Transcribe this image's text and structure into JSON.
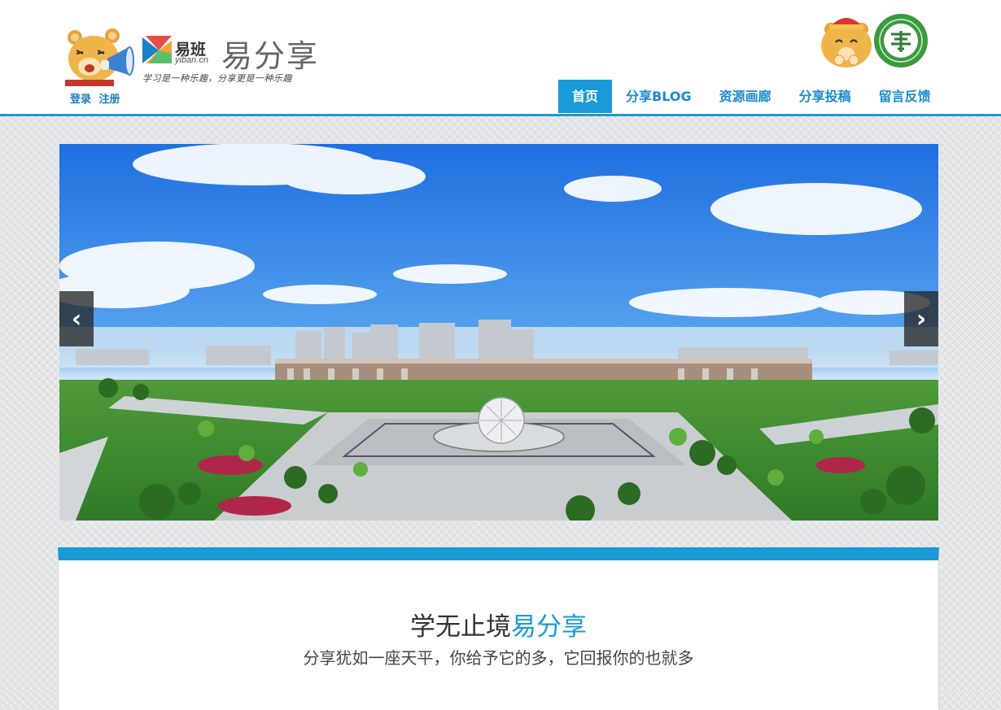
{
  "header": {
    "logo_text": "易班",
    "logo_domain": "yiban.cn",
    "brand": "易分享",
    "slogan": "学习是一种乐趣，分享更是一种乐趣",
    "auth": {
      "login": "登录",
      "register": "注册"
    }
  },
  "nav": {
    "items": [
      {
        "label": "首页",
        "active": true
      },
      {
        "label": "分享BLOG"
      },
      {
        "label": "资源画廊"
      },
      {
        "label": "分享投稿"
      },
      {
        "label": "留言反馈"
      }
    ]
  },
  "carousel": {
    "prev_label": "‹",
    "next_label": "›"
  },
  "intro": {
    "title_main": "学无止境",
    "title_accent": "易分享",
    "subtitle": "分享犹如一座天平，你给予它的多，它回报你的也就多"
  },
  "colors": {
    "accent": "#1a9ad6",
    "nav_text": "#1a8ad0"
  }
}
